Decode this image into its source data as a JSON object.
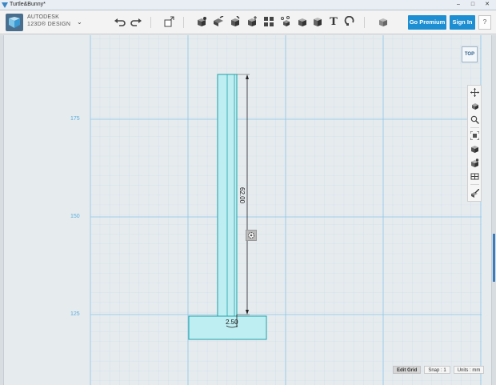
{
  "window": {
    "title": "Turtle&Bunny*",
    "minimize": "–",
    "maximize": "□",
    "close": "✕"
  },
  "brand": {
    "line1": "AUTODESK",
    "line2": "123D® DESIGN",
    "menu_arrow": "⌄"
  },
  "toolbar": {
    "icons": [
      "undo-icon",
      "redo-icon",
      "transform-icon",
      "primitives-icon",
      "sketch-icon",
      "construct-icon",
      "modify-icon",
      "pattern-icon",
      "group-icon",
      "combine-icon",
      "measure-icon",
      "text-icon",
      "snap-icon",
      "material-icon"
    ],
    "text_label": "T",
    "go_premium": "Go Premium",
    "sign_in": "Sign In",
    "help": "?"
  },
  "accent_color": "#1e8ed2",
  "viewcube": {
    "label": "TOP"
  },
  "grid_labels": {
    "y175": "175",
    "y150": "150",
    "y125": "125"
  },
  "dimensions": {
    "height": "62.00",
    "width": "2.50"
  },
  "navigation": [
    "pan-icon",
    "orbit-icon",
    "zoom-icon",
    "fit-icon",
    "perspective-icon",
    "shaded-icon",
    "hidden-icon",
    "toggle-grid-icon"
  ],
  "status": {
    "edit_grid": "Edit Grid",
    "snap": "Snap : 1",
    "units": "Units : mm"
  }
}
